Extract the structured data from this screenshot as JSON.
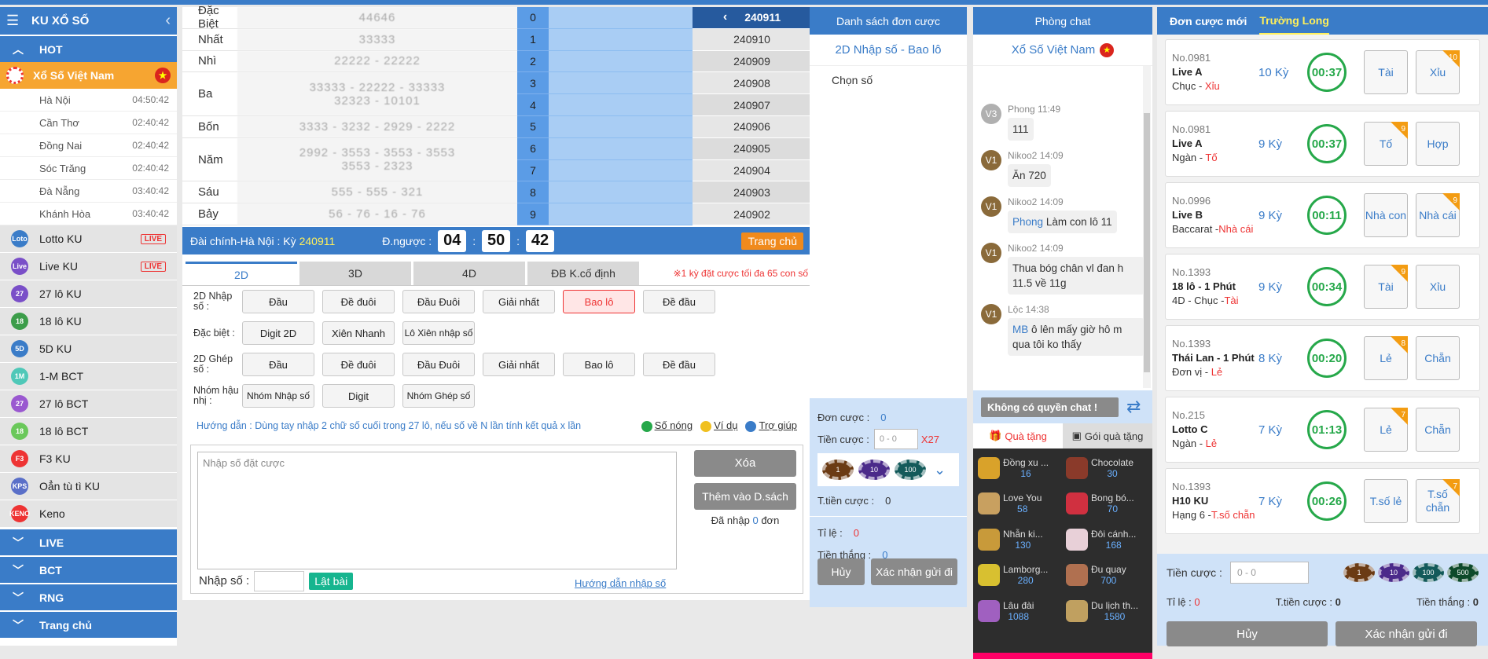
{
  "sidebar": {
    "title": "KU XỔ SỐ",
    "sections": {
      "hot": "HOT",
      "live": "LIVE",
      "bct": "BCT",
      "rng": "RNG",
      "home": "Trang chủ"
    },
    "active": "Xổ Số Việt Nam",
    "subs": [
      {
        "name": "Hà Nội",
        "time": "04:50:42"
      },
      {
        "name": "Cần Thơ",
        "time": "02:40:42"
      },
      {
        "name": "Đồng Nai",
        "time": "02:40:42"
      },
      {
        "name": "Sóc Trăng",
        "time": "02:40:42"
      },
      {
        "name": "Đà Nẵng",
        "time": "03:40:42"
      },
      {
        "name": "Khánh Hòa",
        "time": "03:40:42"
      }
    ],
    "games": [
      {
        "name": "Lotto KU",
        "icon": "Loto",
        "color": "#3a7cc8",
        "live": "LIVE"
      },
      {
        "name": "Live KU",
        "icon": "Live",
        "color": "#7a4fc8",
        "live": "LIVE"
      },
      {
        "name": "27 lô KU",
        "icon": "27",
        "color": "#7a4fc8"
      },
      {
        "name": "18 lô KU",
        "icon": "18",
        "color": "#3c9d4a"
      },
      {
        "name": "5D KU",
        "icon": "5D",
        "color": "#3a7cc8"
      },
      {
        "name": "1-M BCT",
        "icon": "1M",
        "color": "#4fc8b8"
      },
      {
        "name": "27 lô BCT",
        "icon": "27",
        "color": "#9a58d0"
      },
      {
        "name": "18 lô BCT",
        "icon": "18",
        "color": "#6ac85a"
      },
      {
        "name": "F3 KU",
        "icon": "F3",
        "color": "#e33"
      },
      {
        "name": "Oẳn tù tì KU",
        "icon": "KPS",
        "color": "#5a6fc8"
      },
      {
        "name": "Keno",
        "icon": "KENO",
        "color": "#e33"
      }
    ]
  },
  "results": {
    "prizes": [
      {
        "name": "Đặc Biệt",
        "lines": [
          "44646"
        ]
      },
      {
        "name": "Nhất",
        "lines": [
          "33333"
        ]
      },
      {
        "name": "Nhì",
        "lines": [
          "22222 - 22222"
        ]
      },
      {
        "name": "Ba",
        "lines": [
          "33333 - 22222 - 33333",
          "32323 - 10101"
        ]
      },
      {
        "name": "Bốn",
        "lines": [
          "3333 - 3232 - 2929 - 2222"
        ]
      },
      {
        "name": "Năm",
        "lines": [
          "2992 - 3553 - 3553 - 3553",
          "3553 - 2323"
        ]
      },
      {
        "name": "Sáu",
        "lines": [
          "555 - 555 - 321"
        ]
      },
      {
        "name": "Bảy",
        "lines": [
          "56 - 76 - 16 - 76"
        ]
      }
    ],
    "digits": [
      "0",
      "1",
      "2",
      "3",
      "4",
      "5",
      "6",
      "7",
      "8",
      "9"
    ],
    "periods": [
      "240911",
      "240910",
      "240909",
      "240908",
      "240907",
      "240906",
      "240905",
      "240904",
      "240903",
      "240902"
    ]
  },
  "betbar": {
    "label": "Đài chính-Hà Nội : Kỳ",
    "period": "240911",
    "countdown_label": "Đ.ngược :",
    "hh": "04",
    "mm": "50",
    "ss": "42",
    "home": "Trang chủ"
  },
  "input": {
    "tabs": [
      "2D",
      "3D",
      "4D",
      "ĐB K.cố định"
    ],
    "note": "※1 kỳ đặt cược tối đa 65 con số",
    "rows": [
      {
        "label": "2D Nhập số :",
        "buttons": [
          "Đầu",
          "Đề đuôi",
          "Đầu Đuôi",
          "Giải nhất",
          "Bao lô",
          "Đề đầu"
        ]
      },
      {
        "label": "Đặc biệt :",
        "buttons": [
          "Digit 2D",
          "Xiên Nhanh",
          "Lô Xiên nhập số"
        ]
      },
      {
        "label": "2D Ghép số :",
        "buttons": [
          "Đầu",
          "Đề đuôi",
          "Đầu Đuôi",
          "Giải nhất",
          "Bao lô",
          "Đề đầu"
        ]
      },
      {
        "label": "Nhóm hậu nhị :",
        "buttons": [
          "Nhóm Nhập số",
          "Digit",
          "Nhóm Ghép số"
        ]
      }
    ],
    "guide": "Hướng dẫn : Dùng tay nhập 2 chữ số cuối trong 27 lô, nếu số về N lần tính kết quả x lần",
    "links": [
      "Số nóng",
      "Ví dụ",
      "Trợ giúp"
    ],
    "placeholder": "Nhập số đặt cược",
    "delete": "Xóa",
    "add": "Thêm vào D.sách",
    "entered_prefix": "Đã nhập",
    "entered_count": "0",
    "entered_suffix": "đơn",
    "nhapso": "Nhập số :",
    "latbai": "Lật bài",
    "help": "Hướng dẫn nhập số"
  },
  "orders": {
    "header": "Danh sách đơn cược",
    "title": "2D Nhập số - Bao lô",
    "choose": "Chọn số",
    "count_label": "Đơn cược :",
    "count": "0",
    "stake_label": "Tiền cược :",
    "stake_placeholder": "0 - 0",
    "multiplier": "X27",
    "chips": [
      "1",
      "10",
      "100"
    ],
    "total_label": "T.tiền cược :",
    "total": "0",
    "rate_label": "Tỉ lệ :",
    "rate": "0",
    "win_label": "Tiền thắng :",
    "win": "0",
    "cancel": "Hủy",
    "confirm": "Xác nhận gửi đi"
  },
  "chat": {
    "header": "Phòng chat",
    "room": "Xổ Số Việt Nam",
    "messages": [
      {
        "av": "V3",
        "avcolor": "#b0b0b0",
        "user": "Phong 11:49",
        "mention": "",
        "text": "111"
      },
      {
        "av": "V1",
        "avcolor": "#8a6a3a",
        "user": "Nikoo2 14:09",
        "mention": "",
        "text": "Ăn 720"
      },
      {
        "av": "V1",
        "avcolor": "#8a6a3a",
        "user": "Nikoo2 14:09",
        "mention": "Phong",
        "text": "Làm con lô 11"
      },
      {
        "av": "V1",
        "avcolor": "#8a6a3a",
        "user": "Nikoo2 14:09",
        "mention": "",
        "text": "Thua bóg chân vl đan h 11.5 về 11g"
      },
      {
        "av": "V1",
        "avcolor": "#8a6a3a",
        "user": "Lộc 14:38",
        "mention": "MB",
        "text": "ô lên mấy giờ hô m qua tôi ko thấy"
      }
    ],
    "noperm": "Không có quyền chat !",
    "gift_tabs": [
      "Quà tặng",
      "Gói quà tặng"
    ],
    "gifts": [
      {
        "name": "Đồng xu ...",
        "price": "16",
        "color": "#d9a22a"
      },
      {
        "name": "Chocolate",
        "price": "30",
        "color": "#8a3a2a"
      },
      {
        "name": "Love You",
        "price": "58",
        "color": "#c8a060"
      },
      {
        "name": "Bong bó...",
        "price": "70",
        "color": "#d03040"
      },
      {
        "name": "Nhẫn ki...",
        "price": "130",
        "color": "#c89a3a"
      },
      {
        "name": "Đôi cánh...",
        "price": "168",
        "color": "#e8d0d8"
      },
      {
        "name": "Lamborg...",
        "price": "280",
        "color": "#d8c030"
      },
      {
        "name": "Đu quay",
        "price": "700",
        "color": "#b07050"
      },
      {
        "name": "Lâu đài",
        "price": "1088",
        "color": "#a060c0"
      },
      {
        "name": "Du lịch th...",
        "price": "1580",
        "color": "#c0a060"
      }
    ]
  },
  "right": {
    "tabs": [
      "Đơn cược mới",
      "Trường Long"
    ],
    "cards": [
      {
        "no": "No.0981",
        "name": "Live A",
        "sub": "Chục - ",
        "red": "Xỉu",
        "ky": "10 Kỳ",
        "clock": "00:37",
        "o1": "Tài",
        "o2": "Xỉu",
        "b1": "",
        "b2": "10"
      },
      {
        "no": "No.0981",
        "name": "Live A",
        "sub": "Ngàn - ",
        "red": "Tố",
        "ky": "9 Kỳ",
        "clock": "00:37",
        "o1": "Tố",
        "o2": "Hợp",
        "b1": "9",
        "b2": ""
      },
      {
        "no": "No.0996",
        "name": "Live B",
        "sub": "Baccarat -",
        "red": "Nhà cái",
        "ky": "9 Kỳ",
        "clock": "00:11",
        "o1": "Nhà con",
        "o2": "Nhà cái",
        "b1": "",
        "b2": "9"
      },
      {
        "no": "No.1393",
        "name": "18 lô - 1 Phút",
        "sub": "4D - Chục -",
        "red": "Tài",
        "ky": "9 Kỳ",
        "clock": "00:34",
        "o1": "Tài",
        "o2": "Xỉu",
        "b1": "9",
        "b2": ""
      },
      {
        "no": "No.1393",
        "name": "Thái Lan - 1 Phút",
        "sub": "Đơn vị - ",
        "red": "Lẻ",
        "ky": "8 Kỳ",
        "clock": "00:20",
        "o1": "Lẻ",
        "o2": "Chẵn",
        "b1": "8",
        "b2": ""
      },
      {
        "no": "No.215",
        "name": "Lotto C",
        "sub": "Ngàn - ",
        "red": "Lẻ",
        "ky": "7 Kỳ",
        "clock": "01:13",
        "o1": "Lẻ",
        "o2": "Chẵn",
        "b1": "7",
        "b2": ""
      },
      {
        "no": "No.1393",
        "name": "H10 KU",
        "sub": "Hạng 6 -",
        "red": "T.số chẵn",
        "ky": "7 Kỳ",
        "clock": "00:26",
        "o1": "T.số lẻ",
        "o2": "T.số chẵn",
        "b1": "",
        "b2": "7"
      }
    ],
    "stake_label": "Tiền cược :",
    "stake_placeholder": "0 - 0",
    "chips": [
      "1",
      "10",
      "100",
      "500"
    ],
    "rate_label": "Tỉ lệ :",
    "rate": "0",
    "total_label": "T.tiền cược :",
    "total": "0",
    "win_label": "Tiền thắng :",
    "win": "0",
    "cancel": "Hủy",
    "confirm": "Xác nhận gửi đi"
  }
}
